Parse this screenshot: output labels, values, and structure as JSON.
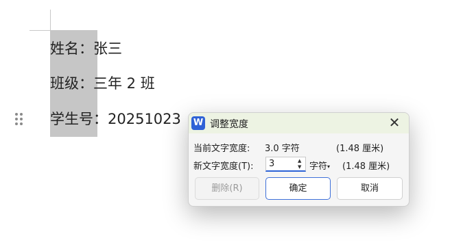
{
  "document": {
    "name_label": "姓名：",
    "name_value": "张三",
    "class_label": "班级：",
    "class_value": "三年 2 班",
    "student_label": "学生号：",
    "student_value": "20251023"
  },
  "dialog": {
    "app_icon": "W",
    "title": "调整宽度",
    "current_label": "当前文字宽度:",
    "current_value": "3.0 字符",
    "current_cm": "(1.48 厘米)",
    "new_label": "新文字宽度(T):",
    "new_value": "3",
    "unit": "字符",
    "new_cm": "(1.48 厘米)",
    "delete_label": "删除(R)",
    "ok_label": "确定",
    "cancel_label": "取消"
  },
  "colors": {
    "selection": "#c6c6c6",
    "title_bar": "#edf3e3",
    "accent": "#2b62d6"
  }
}
